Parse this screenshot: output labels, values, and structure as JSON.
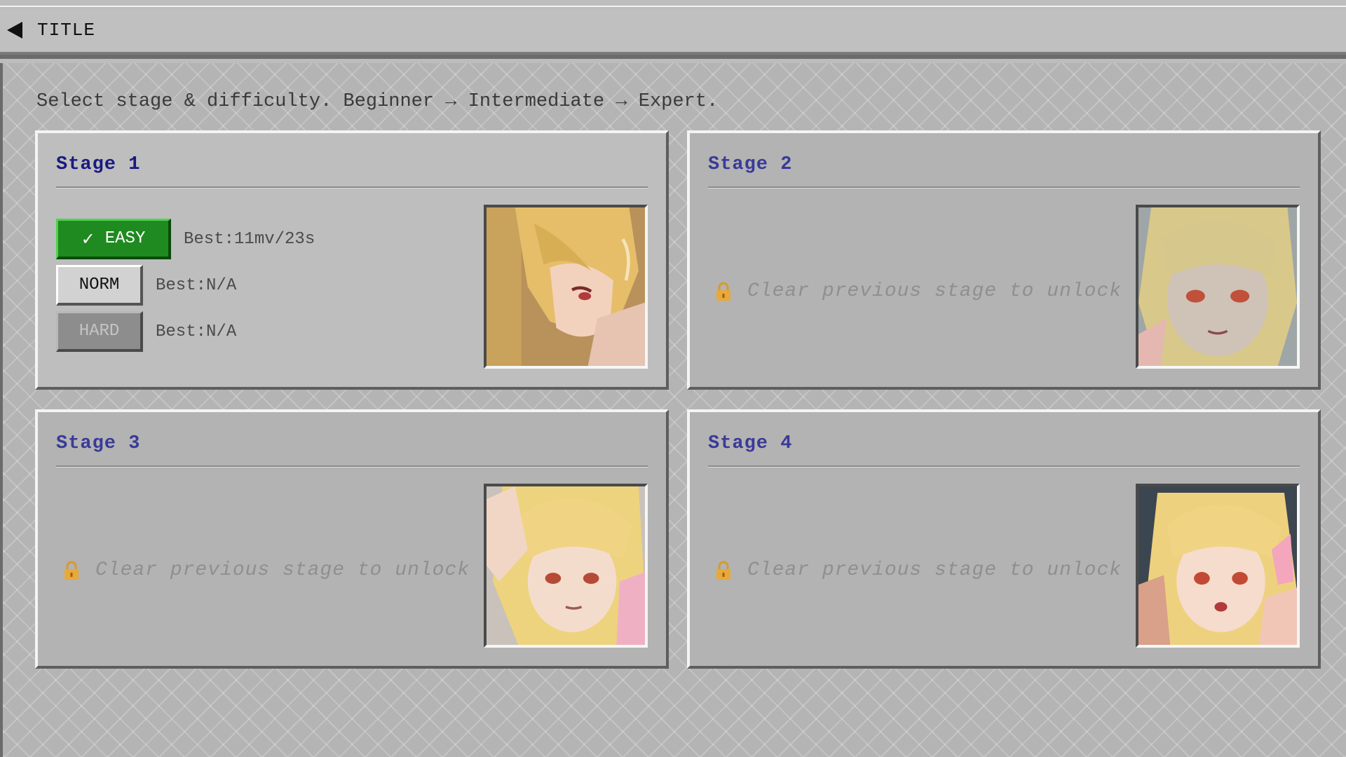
{
  "header": {
    "back_label": "TITLE"
  },
  "instruction": "Select stage & difficulty. Beginner → Intermediate → Expert.",
  "stages": [
    {
      "title": "Stage 1",
      "unlocked": true,
      "difficulties": [
        {
          "label": "EASY",
          "check": "✓",
          "best": "Best:11mv/23s",
          "state": "cleared"
        },
        {
          "label": "NORM",
          "best": "Best:N/A",
          "state": "available"
        },
        {
          "label": "HARD",
          "best": "Best:N/A",
          "state": "disabled"
        }
      ]
    },
    {
      "title": "Stage 2",
      "unlocked": false,
      "locked_text": "Clear previous stage to unlock"
    },
    {
      "title": "Stage 3",
      "unlocked": false,
      "locked_text": "Clear previous stage to unlock"
    },
    {
      "title": "Stage 4",
      "unlocked": false,
      "locked_text": "Clear previous stage to unlock"
    }
  ],
  "colors": {
    "easy_green": "#1f8a1f",
    "title_blue": "#1a1a80",
    "hair": "#e8c46a",
    "skin": "#f3d6c4",
    "eye": "#c0392b"
  }
}
